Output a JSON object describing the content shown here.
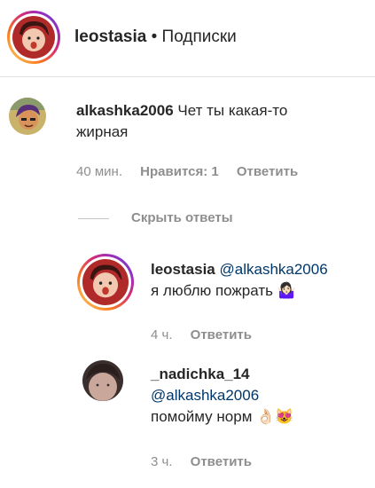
{
  "header": {
    "username": "leostasia",
    "separator": "•",
    "title": "Подписки"
  },
  "comment": {
    "username": "alkashka2006",
    "text_line1": "Чет ты какая-то",
    "text_line2": "жирная",
    "time": "40 мин.",
    "likes": "Нравится: 1",
    "reply": "Ответить"
  },
  "hide_replies": "Скрыть ответы",
  "replies": [
    {
      "username": "leostasia",
      "mention": "@alkashka2006",
      "text": "я люблю пожрать 🤷🏻‍♀️",
      "time": "4 ч.",
      "reply": "Ответить"
    },
    {
      "username": "_nadichka_14",
      "mention": "@alkashka2006",
      "text": "помойму норм 👌🏻😻",
      "time": "3 ч.",
      "reply": "Ответить"
    }
  ],
  "colors": {
    "mention": "#00376b",
    "muted": "#8e8e8e",
    "text": "#262626"
  }
}
